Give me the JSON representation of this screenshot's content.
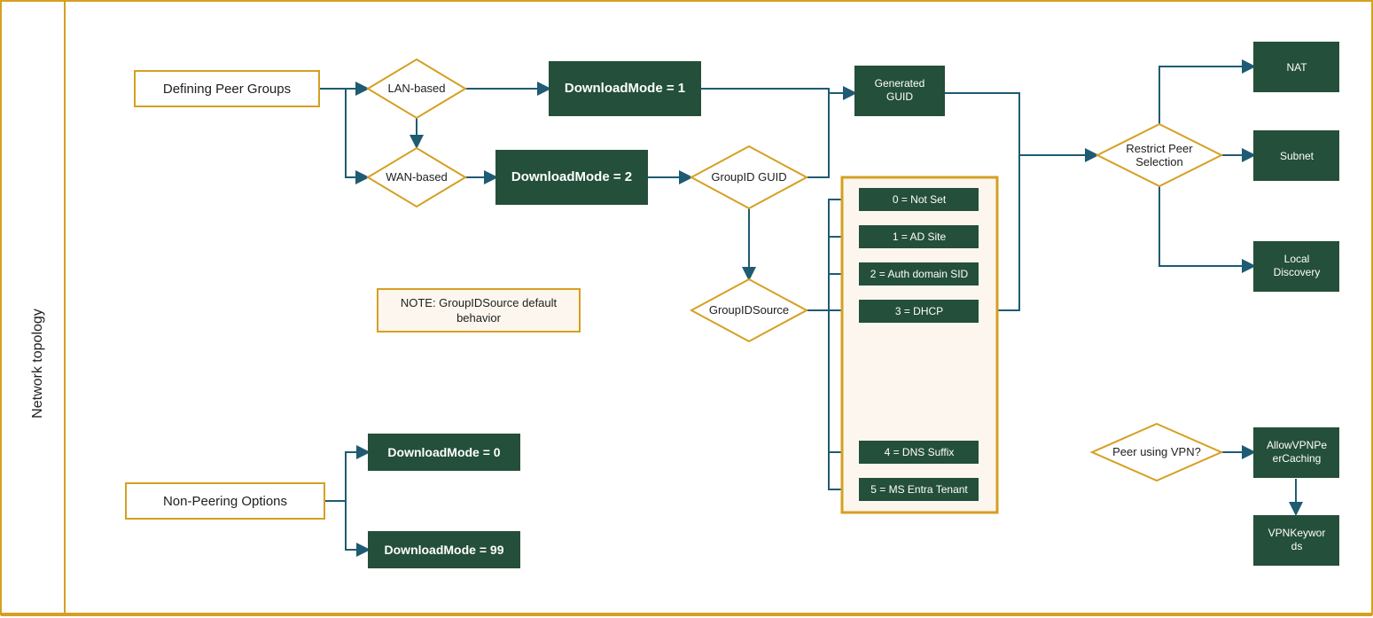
{
  "sideTitle": "Network topology",
  "definingPeerGroups": "Defining Peer Groups",
  "nonPeeringOptions": "Non-Peering Options",
  "lanBased": "LAN-based",
  "wanBased": "WAN-based",
  "dm1": "DownloadMode = 1",
  "dm2": "DownloadMode = 2",
  "dm0": "DownloadMode = 0",
  "dm99": "DownloadMode = 99",
  "groupIdGuid": "GroupID GUID",
  "generatedGuid1": "Generated",
  "generatedGuid2": "GUID",
  "groupIdSource": "GroupIDSource",
  "note1": "NOTE: GroupIDSource default",
  "note2": "behavior",
  "opt0": "0 = Not Set",
  "opt1": "1 = AD Site",
  "opt2": "2 = Auth domain SID",
  "opt3": "3 = DHCP",
  "opt4": "4 = DNS Suffix",
  "opt5": "5 = MS Entra Tenant",
  "restrict1": "Restrict Peer",
  "restrict2": "Selection",
  "nat": "NAT",
  "subnet": "Subnet",
  "local1": "Local",
  "local2": "Discovery",
  "peerVpn": "Peer using VPN?",
  "allowVpn1": "AllowVPNPe",
  "allowVpn2": "erCaching",
  "vpnKw1": "VPNKeywor",
  "vpnKw2": "ds"
}
